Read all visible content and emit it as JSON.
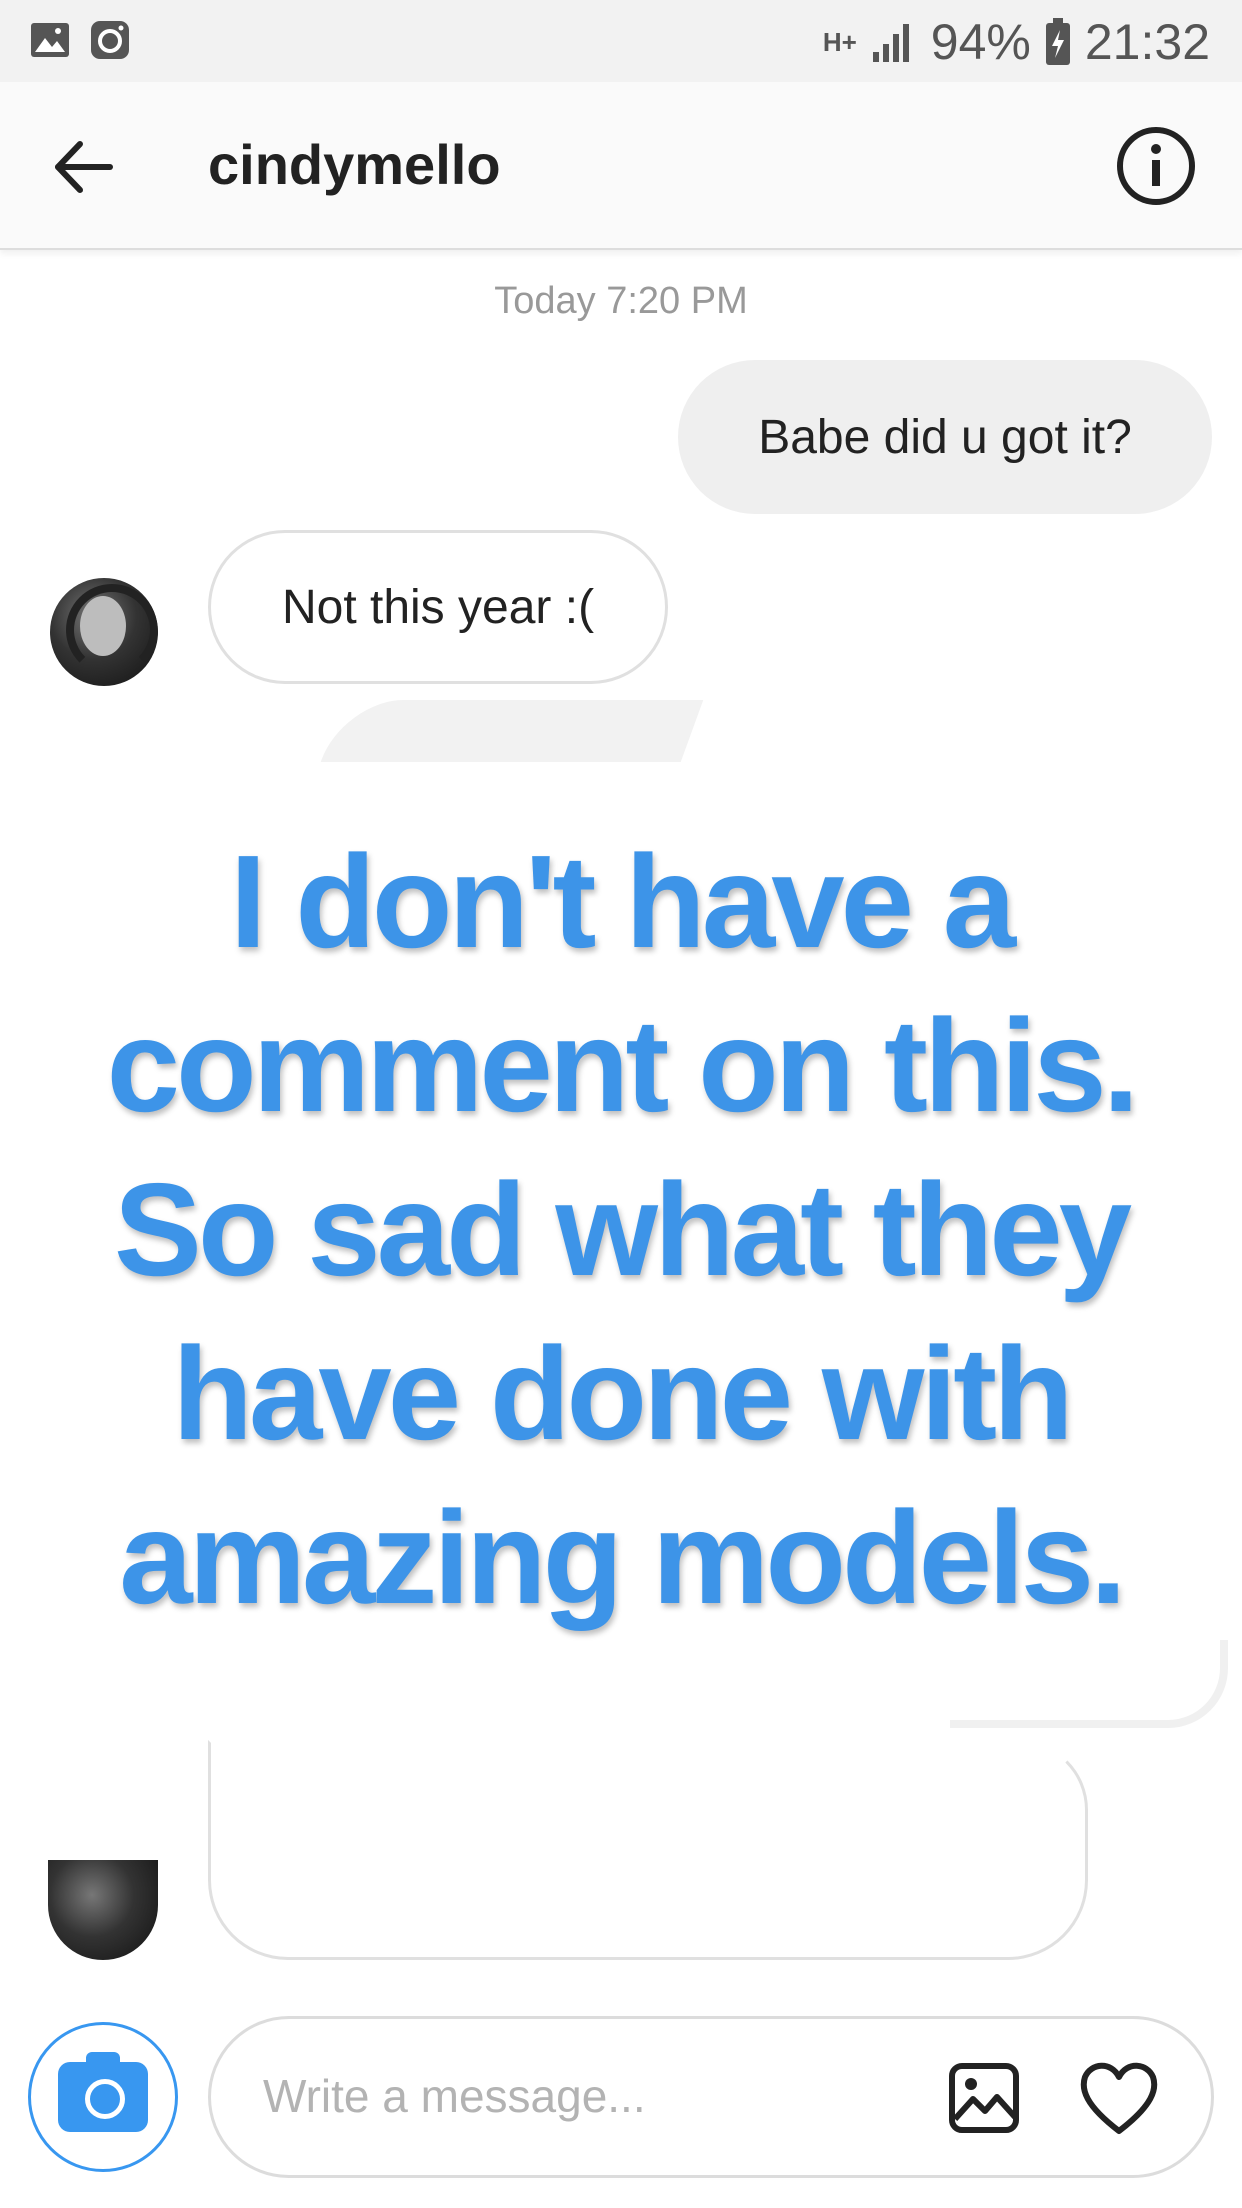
{
  "status_bar": {
    "network": "H+",
    "battery": "94%",
    "time": "21:32",
    "icons": [
      "gallery-icon",
      "instagram-icon",
      "signal-icon",
      "battery-icon"
    ]
  },
  "header": {
    "title": "cindymello",
    "back_icon": "arrow-left-icon",
    "info_icon": "info-icon"
  },
  "chat": {
    "timestamp": "Today 7:20 PM",
    "messages": [
      {
        "from": "me",
        "text": "Babe did u got it?"
      },
      {
        "from": "cindymello",
        "text": "Not this year :("
      }
    ]
  },
  "overlay": {
    "lines": [
      "I don't have a",
      "comment on this.",
      "So sad what they",
      "have done with",
      "amazing models."
    ],
    "color": "#3d94e8"
  },
  "composer": {
    "placeholder": "Write a message...",
    "camera_icon": "camera-icon",
    "gallery_icon": "image-icon",
    "like_icon": "heart-icon",
    "accent": "#3897f0"
  }
}
